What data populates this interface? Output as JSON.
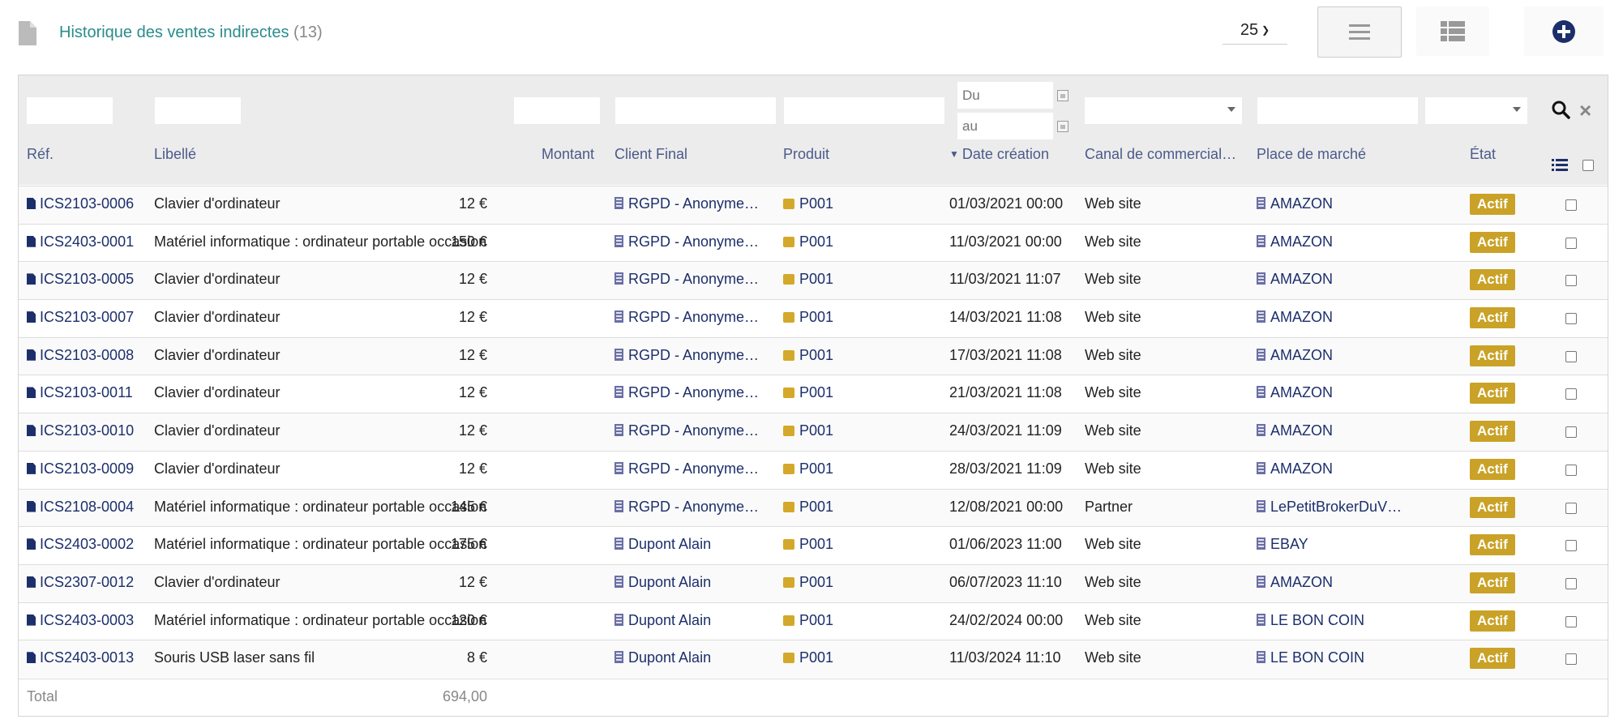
{
  "header": {
    "title": "Historique des ventes indirectes",
    "count": "(13)",
    "per_page": "25"
  },
  "filters": {
    "date_from_placeholder": "Du",
    "date_to_placeholder": "au"
  },
  "columns": {
    "ref": "Réf.",
    "libelle": "Libellé",
    "montant": "Montant",
    "client": "Client Final",
    "produit": "Produit",
    "date": "Date création",
    "canal": "Canal de commercial…",
    "place": "Place de marché",
    "etat": "État"
  },
  "rows": [
    {
      "ref": "ICS2103-0006",
      "libelle": "Clavier d'ordinateur",
      "montant": "12 €",
      "client": "RGPD - Anonyme…",
      "produit": "P001",
      "date": "01/03/2021 00:00",
      "canal": "Web site",
      "place": "AMAZON",
      "etat": "Actif"
    },
    {
      "ref": "ICS2403-0001",
      "libelle": "Matériel informatique : ordinateur portable occasion",
      "montant": "150 €",
      "client": "RGPD - Anonyme…",
      "produit": "P001",
      "date": "11/03/2021 00:00",
      "canal": "Web site",
      "place": "AMAZON",
      "etat": "Actif"
    },
    {
      "ref": "ICS2103-0005",
      "libelle": "Clavier d'ordinateur",
      "montant": "12 €",
      "client": "RGPD - Anonyme…",
      "produit": "P001",
      "date": "11/03/2021 11:07",
      "canal": "Web site",
      "place": "AMAZON",
      "etat": "Actif"
    },
    {
      "ref": "ICS2103-0007",
      "libelle": "Clavier d'ordinateur",
      "montant": "12 €",
      "client": "RGPD - Anonyme…",
      "produit": "P001",
      "date": "14/03/2021 11:08",
      "canal": "Web site",
      "place": "AMAZON",
      "etat": "Actif"
    },
    {
      "ref": "ICS2103-0008",
      "libelle": "Clavier d'ordinateur",
      "montant": "12 €",
      "client": "RGPD - Anonyme…",
      "produit": "P001",
      "date": "17/03/2021 11:08",
      "canal": "Web site",
      "place": "AMAZON",
      "etat": "Actif"
    },
    {
      "ref": "ICS2103-0011",
      "libelle": "Clavier d'ordinateur",
      "montant": "12 €",
      "client": "RGPD - Anonyme…",
      "produit": "P001",
      "date": "21/03/2021 11:08",
      "canal": "Web site",
      "place": "AMAZON",
      "etat": "Actif"
    },
    {
      "ref": "ICS2103-0010",
      "libelle": "Clavier d'ordinateur",
      "montant": "12 €",
      "client": "RGPD - Anonyme…",
      "produit": "P001",
      "date": "24/03/2021 11:09",
      "canal": "Web site",
      "place": "AMAZON",
      "etat": "Actif"
    },
    {
      "ref": "ICS2103-0009",
      "libelle": "Clavier d'ordinateur",
      "montant": "12 €",
      "client": "RGPD - Anonyme…",
      "produit": "P001",
      "date": "28/03/2021 11:09",
      "canal": "Web site",
      "place": "AMAZON",
      "etat": "Actif"
    },
    {
      "ref": "ICS2108-0004",
      "libelle": "Matériel informatique : ordinateur portable occasion",
      "montant": "145 €",
      "client": "RGPD - Anonyme…",
      "produit": "P001",
      "date": "12/08/2021 00:00",
      "canal": "Partner",
      "place": "LePetitBrokerDuV…",
      "etat": "Actif"
    },
    {
      "ref": "ICS2403-0002",
      "libelle": "Matériel informatique : ordinateur portable occasion",
      "montant": "175 €",
      "client": "Dupont Alain",
      "produit": "P001",
      "date": "01/06/2023 11:00",
      "canal": "Web site",
      "place": "EBAY",
      "etat": "Actif"
    },
    {
      "ref": "ICS2307-0012",
      "libelle": "Clavier d'ordinateur",
      "montant": "12 €",
      "client": "Dupont Alain",
      "produit": "P001",
      "date": "06/07/2023 11:10",
      "canal": "Web site",
      "place": "AMAZON",
      "etat": "Actif"
    },
    {
      "ref": "ICS2403-0003",
      "libelle": "Matériel informatique : ordinateur portable occasion",
      "montant": "120 €",
      "client": "Dupont Alain",
      "produit": "P001",
      "date": "24/02/2024 00:00",
      "canal": "Web site",
      "place": "LE BON COIN",
      "etat": "Actif"
    },
    {
      "ref": "ICS2403-0013",
      "libelle": "Souris USB laser sans fil",
      "montant": "8 €",
      "client": "Dupont Alain",
      "produit": "P001",
      "date": "11/03/2024 11:10",
      "canal": "Web site",
      "place": "LE BON COIN",
      "etat": "Actif"
    }
  ],
  "total": {
    "label": "Total",
    "value": "694,00"
  }
}
